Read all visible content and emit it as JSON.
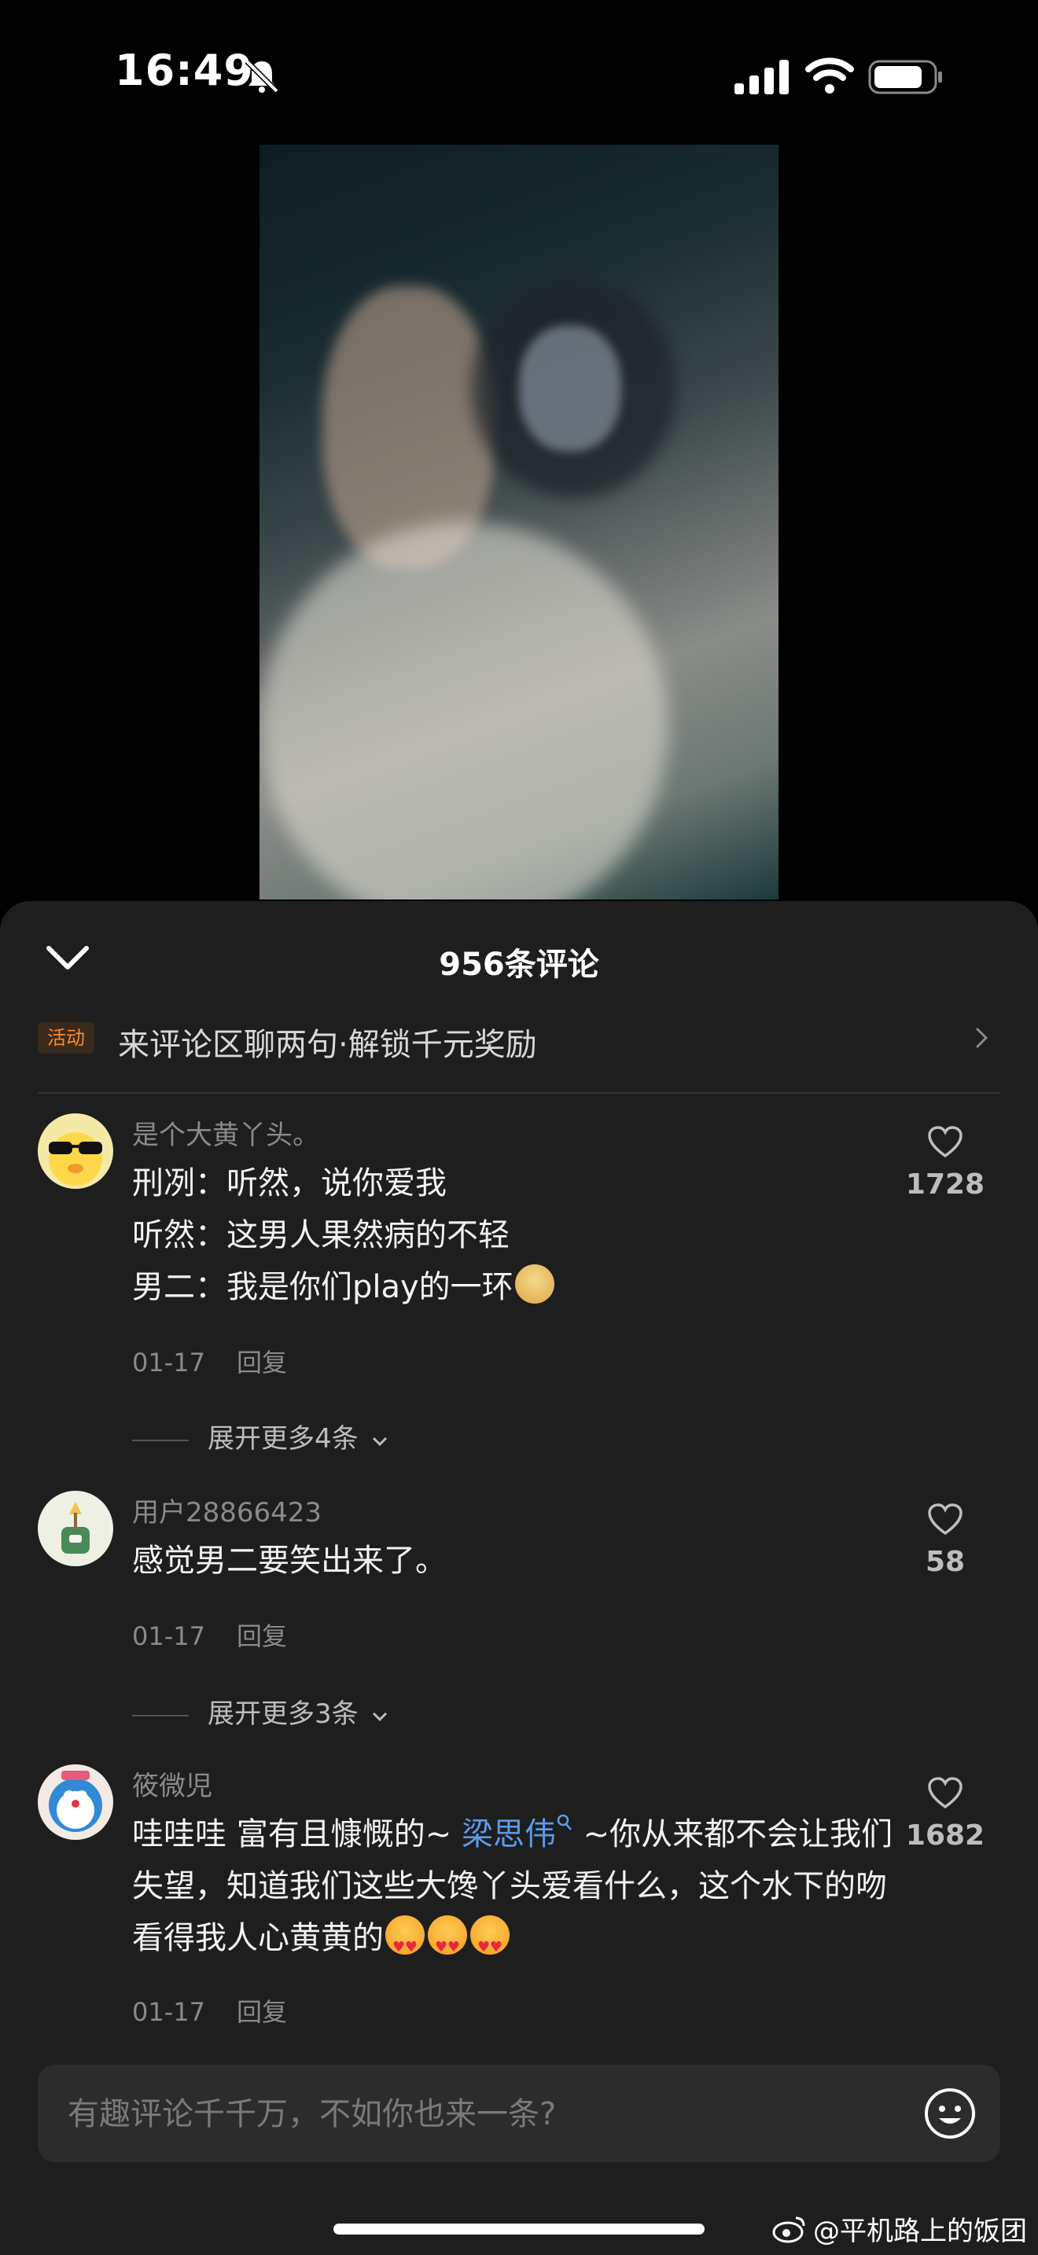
{
  "status_bar": {
    "time": "16:49"
  },
  "video": {
    "playing": true
  },
  "comments_sheet": {
    "title": "956条评论",
    "promo": {
      "badge": "活动",
      "text": "来评论区聊两句·解锁千元奖励"
    },
    "comments": [
      {
        "username": "是个大黄丫头。",
        "lines": [
          "刑冽：听然，说你爱我",
          "听然：这男人果然病的不轻",
          "男二：我是你们play的一环"
        ],
        "date": "01-17",
        "reply": "回复",
        "likes": "1728",
        "expand": "展开更多4条"
      },
      {
        "username": "用户28866423",
        "lines": [
          "感觉男二要笑出来了。"
        ],
        "date": "01-17",
        "reply": "回复",
        "likes": "58",
        "expand": "展开更多3条"
      },
      {
        "username": "筱微児",
        "text_before": "哇哇哇 富有且慷慨的~ ",
        "mention": "梁思伟",
        "text_after": " ~你从来都不会让我们失望，知道我们这些大馋丫头爱看什么，这个水下的吻看得我人心黄黄的",
        "date": "01-17",
        "reply": "回复",
        "likes": "1682"
      }
    ],
    "input_placeholder": "有趣评论千千万，不如你也来一条?"
  },
  "watermark": "@平机路上的饭团"
}
